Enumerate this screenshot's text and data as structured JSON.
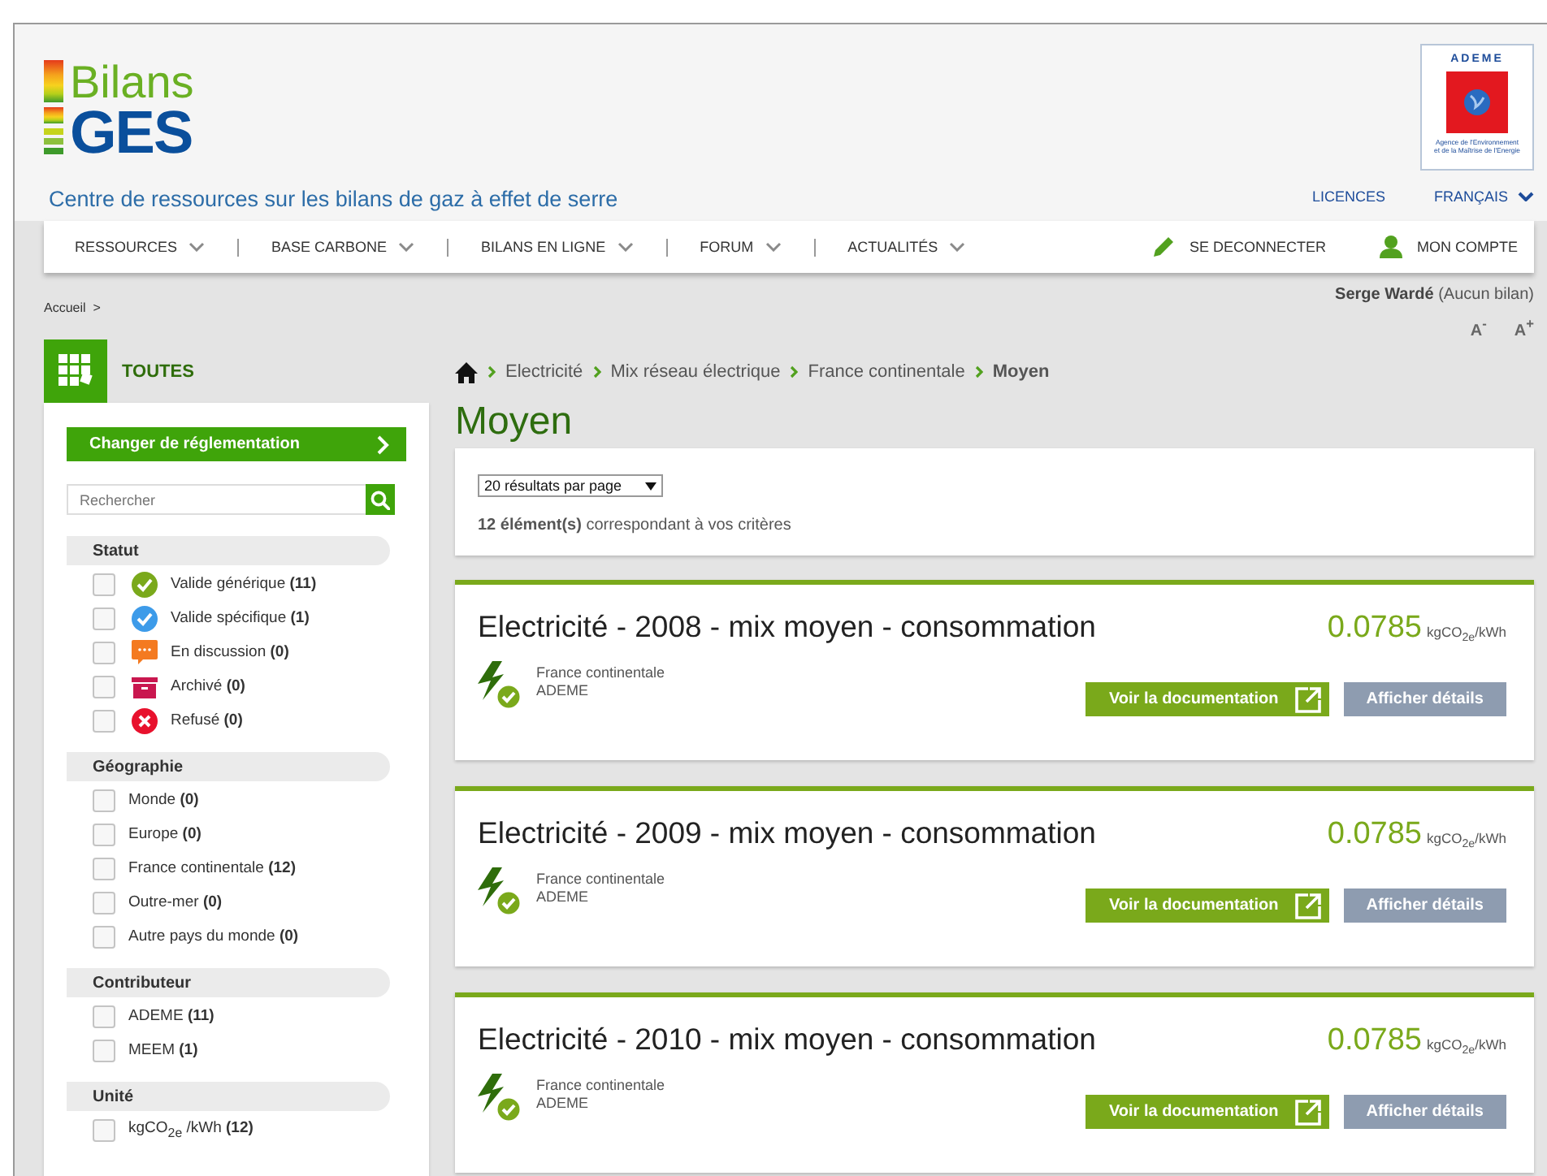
{
  "header": {
    "logo": {
      "line1": "Bilans",
      "line2": "GES"
    },
    "tagline": "Centre de ressources sur les bilans de gaz à effet de serre",
    "partner_logo": {
      "name": "ADEME",
      "caption": [
        "Agence de l'Environnement",
        "et de la Maîtrise de l'Energie"
      ]
    },
    "links": [
      {
        "label": "LICENCES",
        "kind": "link"
      },
      {
        "label": "FRANÇAIS",
        "kind": "dropdown"
      }
    ]
  },
  "nav": {
    "items": [
      {
        "label": "RESSOURCES"
      },
      {
        "label": "BASE CARBONE"
      },
      {
        "label": "BILANS EN LIGNE"
      },
      {
        "label": "FORUM"
      },
      {
        "label": "ACTUALITÉS"
      }
    ],
    "account": [
      {
        "kind": "logout",
        "label": "SE DECONNECTER"
      },
      {
        "kind": "account",
        "label": "MON COMPTE"
      }
    ]
  },
  "top_bar": {
    "home_crumb": "Accueil  >",
    "user": "**Serge Wardé** (Aucun bilan)",
    "font_buttons": [
      "A$^{-}$",
      "A$^{+}$"
    ]
  },
  "sidebar": {
    "category": "TOUTES",
    "regulation_button": "Changer de réglementation",
    "search": {
      "placeholder": "Rechercher"
    },
    "groups": [
      {
        "title": "Statut",
        "options": [
          {
            "label": "Valide générique **(11)**",
            "checked": false,
            "kind": "valid-generic"
          },
          {
            "label": "Valide spécifique **(1)**",
            "checked": false,
            "kind": "valid-specific"
          },
          {
            "label": "En discussion **(0)**",
            "checked": false,
            "kind": "discussion"
          },
          {
            "label": "Archivé **(0)**",
            "checked": false,
            "kind": "archived"
          },
          {
            "label": "Refusé **(0)**",
            "checked": false,
            "kind": "refused"
          }
        ]
      },
      {
        "title": "Géographie",
        "options": [
          {
            "label": "Monde **(0)**",
            "checked": false
          },
          {
            "label": "Europe **(0)**",
            "checked": false
          },
          {
            "label": "France continentale **(12)**",
            "checked": false
          },
          {
            "label": "Outre-mer **(0)**",
            "checked": false
          },
          {
            "label": "Autre pays du monde **(0)**",
            "checked": false
          }
        ]
      },
      {
        "title": "Contributeur",
        "options": [
          {
            "label": "ADEME **(11)**",
            "checked": false
          },
          {
            "label": "MEEM **(1)**",
            "checked": false
          }
        ]
      },
      {
        "title": "Unité",
        "options": [
          {
            "label": "kgCO$_{2e}$ /kWh **(12)**",
            "checked": false
          }
        ]
      }
    ]
  },
  "main": {
    "breadcrumb": [
      {
        "label": "Electricité",
        "current": false
      },
      {
        "label": "Mix réseau électrique",
        "current": false
      },
      {
        "label": "France continentale",
        "current": false
      },
      {
        "label": "Moyen",
        "current": true
      }
    ],
    "title": "Moyen",
    "per_page": "20 résultats par page",
    "count": "**12 élément(s)** correspondant à vos critères",
    "cards": [
      {
        "title": "Electricité - 2008 - mix moyen - consommation",
        "value": "0.0785",
        "unit": "kgCO$_{2e}$/kWh",
        "location": "France continentale",
        "source": "ADEME",
        "doc_button": "Voir la documentation",
        "details_button": "Afficher détails"
      },
      {
        "title": "Electricité - 2009 - mix moyen - consommation",
        "value": "0.0785",
        "unit": "kgCO$_{2e}$/kWh",
        "location": "France continentale",
        "source": "ADEME",
        "doc_button": "Voir la documentation",
        "details_button": "Afficher détails"
      },
      {
        "title": "Electricité - 2010 - mix moyen - consommation",
        "value": "0.0785",
        "unit": "kgCO$_{2e}$/kWh",
        "location": "France continentale",
        "source": "ADEME",
        "doc_button": "Voir la documentation",
        "details_button": "Afficher détails"
      }
    ]
  }
}
